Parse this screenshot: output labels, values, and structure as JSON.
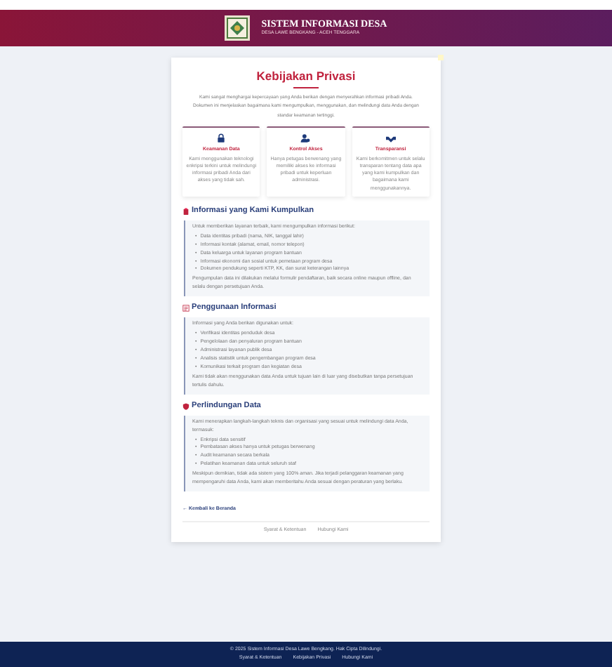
{
  "header": {
    "title": "SISTEM INFORMASI DESA",
    "subtitle": "DESA LAWE BENGKANG - ACEH TENGGARA"
  },
  "page": {
    "title": "Kebijakan Privasi",
    "intro": "Kami sangat menghargai kepercayaan yang Anda berikan dengan menyerahkan informasi pribadi Anda. Dokumen ini menjelaskan bagaimana kami mengumpulkan, menggunakan, dan melindungi data Anda dengan standar keamanan tertinggi."
  },
  "features": [
    {
      "title": "Keamanan Data",
      "text": "Kami menggunakan teknologi enkripsi terkini untuk melindungi informasi pribadi Anda dari akses yang tidak sah."
    },
    {
      "title": "Kontrol Akses",
      "text": "Hanya petugas berwenang yang memiliki akses ke informasi pribadi untuk keperluan administrasi."
    },
    {
      "title": "Transparansi",
      "text": "Kami berkomitmen untuk selalu transparan tentang data apa yang kami kumpulkan dan bagaimana kami menggunakannya."
    }
  ],
  "sections": [
    {
      "title": "Informasi yang Kami Kumpulkan",
      "bullet": "•",
      "lead": "Untuk memberikan layanan terbaik, kami mengumpulkan informasi berikut:",
      "items": [
        "Data identitas pribadi (nama, NIK, tanggal lahir)",
        "Informasi kontak (alamat, email, nomor telepon)",
        "Data keluarga untuk layanan program bantuan",
        "Informasi ekonomi dan sosial untuk pemetaan program desa",
        "Dokumen pendukung seperti KTP, KK, dan surat keterangan lainnya"
      ],
      "note": "Pengumpulan data ini dilakukan melalui formulir pendaftaran, baik secara online maupun offline, dan selalu dengan persetujuan Anda."
    },
    {
      "title": "Penggunaan Informasi",
      "bullet": "•",
      "lead": "Informasi yang Anda berikan digunakan untuk:",
      "items": [
        "Verifikasi identitas penduduk desa",
        "Pengelolaan dan penyaluran program bantuan",
        "Administrasi layanan publik desa",
        "Analisis statistik untuk pengembangan program desa",
        "Komunikasi terkait program dan kegiatan desa"
      ],
      "note": "Kami tidak akan menggunakan data Anda untuk tujuan lain di luar yang disebutkan tanpa persetujuan tertulis dahulu."
    },
    {
      "title": "Perlindungan Data",
      "bullet": "•",
      "lead": "Kami menerapkan langkah-langkah teknis dan organisasi yang sesuai untuk melindungi data Anda, termasuk:",
      "items": [
        "Enkripsi data sensitif",
        "Pembatasan akses hanya untuk petugas berwenang",
        "Audit keamanan secara berkala",
        "Pelatihan keamanan data untuk seluruh staf"
      ],
      "note": "Meskipun demikian, tidak ada sistem yang 100% aman. Jika terjadi pelanggaran keamanan yang mempengaruhi data Anda, kami akan memberitahu Anda sesuai dengan peraturan yang berlaku."
    }
  ],
  "back_link": "← Kembali ke Beranda",
  "card_links": [
    "Syarat & Ketentuan",
    "Hubungi Kami"
  ],
  "footer": {
    "copyright": "© 2025 Sistem Informasi Desa Lawe Bengkang. Hak Cipta Dilindungi.",
    "links": [
      "Syarat & Ketentuan",
      "Kebijakan Privasi",
      "Hubungi Kami"
    ]
  }
}
